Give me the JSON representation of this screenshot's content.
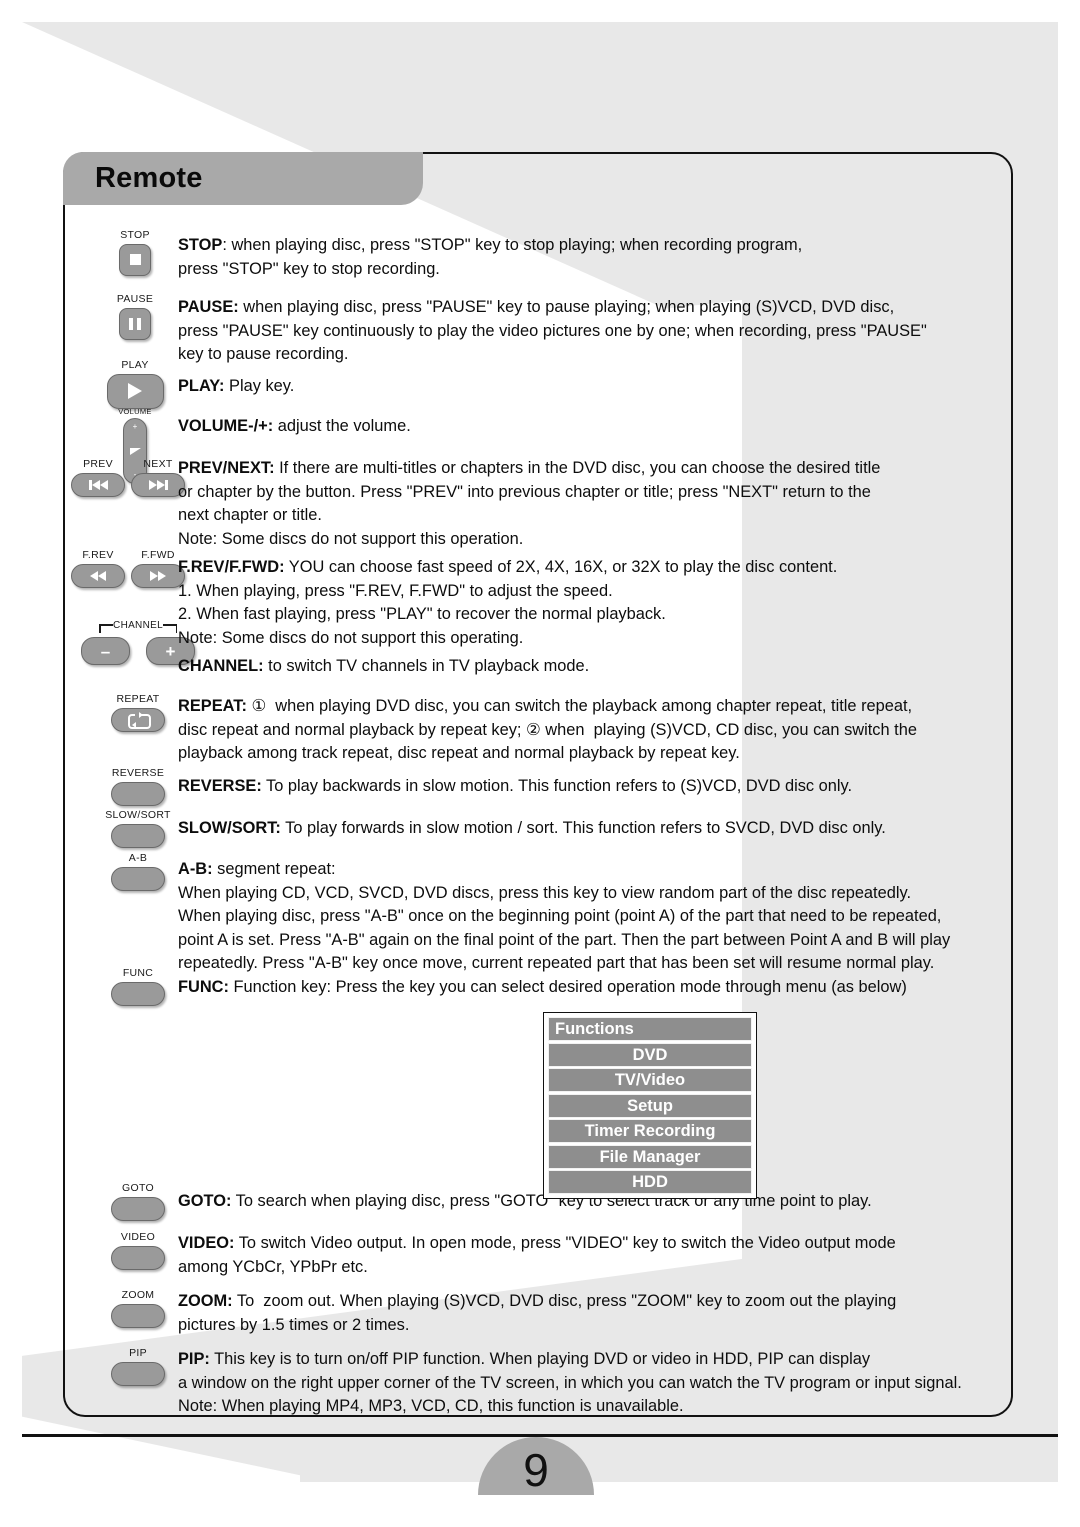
{
  "header": {
    "title": "Remote"
  },
  "page": {
    "number": "9"
  },
  "keys": [
    {
      "name": "stop",
      "label": "STOP",
      "icon": "stop-icon"
    },
    {
      "name": "pause",
      "label": "PAUSE",
      "icon": "pause-icon"
    },
    {
      "name": "play",
      "label": "PLAY",
      "icon": "play-icon"
    },
    {
      "name": "volume",
      "label": "VOLUME",
      "icon": "volume-rocker-icon",
      "plus": "+",
      "minus": "-"
    },
    {
      "name": "prev",
      "label": "PREV",
      "icon": "previous-track-icon"
    },
    {
      "name": "next",
      "label": "NEXT",
      "icon": "next-track-icon"
    },
    {
      "name": "frev",
      "label": "F.REV",
      "icon": "fast-rewind-icon"
    },
    {
      "name": "ffwd",
      "label": "F.FWD",
      "icon": "fast-forward-icon"
    },
    {
      "name": "channel",
      "label": "CHANNEL",
      "icon": "channel-rocker-icon",
      "minus": "–",
      "plus": "+"
    },
    {
      "name": "repeat",
      "label": "REPEAT",
      "icon": "repeat-loop-icon"
    },
    {
      "name": "reverse",
      "label": "REVERSE",
      "icon": "blank-key-icon"
    },
    {
      "name": "slowsort",
      "label": "SLOW/SORT",
      "icon": "blank-key-icon"
    },
    {
      "name": "ab",
      "label": "A-B",
      "icon": "blank-key-icon"
    },
    {
      "name": "func",
      "label": "FUNC",
      "icon": "blank-key-icon"
    },
    {
      "name": "goto",
      "label": "GOTO",
      "icon": "blank-key-icon"
    },
    {
      "name": "video",
      "label": "VIDEO",
      "icon": "blank-key-icon"
    },
    {
      "name": "zoom",
      "label": "ZOOM",
      "icon": "blank-key-icon"
    },
    {
      "name": "pip",
      "label": "PIP",
      "icon": "blank-key-icon"
    }
  ],
  "sections": {
    "stop_term": "STOP",
    "stop_body": ": when playing disc, press \"STOP\" key to stop playing; when recording program,\npress \"STOP\" key to stop recording.",
    "pause_term": "PAUSE:",
    "pause_body": " when playing disc, press \"PAUSE\" key to pause playing; when playing (S)VCD, DVD disc,\npress \"PAUSE\" key continuously to play the video pictures one by one; when recording, press \"PAUSE\"\nkey to pause recording.",
    "play_term": "PLAY:",
    "play_body": " Play key.",
    "volume_term": "VOLUME-/+:",
    "volume_body": " adjust the volume.",
    "prevnext_term": "PREV/NEXT:",
    "prevnext_body": " If there are multi-titles or chapters in the DVD disc, you can choose the desired title\nor chapter by the button. Press \"PREV\" into previous chapter or title; press \"NEXT\" return to the\nnext chapter or title.\nNote: Some discs do not support this operation.",
    "frevffwd_term": "F.REV/F.FWD:",
    "frevffwd_body": " YOU can choose fast speed of 2X, 4X, 16X, or 32X to play the disc content.\n1. When playing, press \"F.REV, F.FWD\" to adjust the speed.\n2. When fast playing, press \"PLAY\" to recover the normal playback.\nNote: Some discs do not support this operating.",
    "channel_term": "CHANNEL:",
    "channel_body": " to switch TV channels in TV playback mode.",
    "repeat_term": "REPEAT:",
    "repeat_body": " ①  when playing DVD disc, you can switch the playback among chapter repeat, title repeat,\ndisc repeat and normal playback by repeat key; ② when  playing (S)VCD, CD disc, you can switch the\nplayback among track repeat, disc repeat and normal playback by repeat key.",
    "reverse_term": "REVERSE:",
    "reverse_body": " To play backwards in slow motion. This function refers to (S)VCD, DVD disc only.",
    "slowsort_term": "SLOW/SORT:",
    "slowsort_body": " To play forwards in slow motion / sort. This function refers to SVCD, DVD disc only.",
    "ab_term": "A-B:",
    "ab_body": " segment repeat:\nWhen playing CD, VCD, SVCD, DVD discs, press this key to view random part of the disc repeatedly.\nWhen playing disc, press \"A-B\" once on the beginning point (point A) of the part that need to be repeated,\npoint A is set. Press \"A-B\" again on the final point of the part. Then the part between Point A and B will play\nrepeatedly. Press \"A-B\" key once move, current repeated part that has been set will resume normal play.",
    "func_term": "FUNC:",
    "func_body": " Function key: Press the key you can select desired operation mode through menu (as below)",
    "goto_term": "GOTO:",
    "goto_body": " To search when playing disc, press \"GOTO\" key to select track or any time point to play.",
    "video_term": "VIDEO:",
    "video_body": " To switch Video output. In open mode, press \"VIDEO\" key to switch the Video output mode\namong YCbCr, YPbPr etc.",
    "zoom_term": "ZOOM:",
    "zoom_body": " To  zoom out. When playing (S)VCD, DVD disc, press \"ZOOM\" key to zoom out the playing\npictures by 1.5 times or 2 times.",
    "pip_term": "PIP:",
    "pip_body": " This key is to turn on/off PIP function. When playing DVD or video in HDD, PIP can display\na window on the right upper corner of the TV screen, in which you can watch the TV program or input signal.\nNote: When playing MP4, MP3, VCD, CD, this function is unavailable."
  },
  "functions_menu": {
    "title": "Functions",
    "items": [
      "DVD",
      "TV/Video",
      "Setup",
      "Timer Recording",
      "File Manager",
      "HDD"
    ]
  },
  "colors": {
    "page_bg": "#e8e8e8",
    "header_bar": "#a9a9a9",
    "key_face": "#9a9a9a",
    "menu_item": "#8e8e8e",
    "text": "#0d0d0d"
  }
}
